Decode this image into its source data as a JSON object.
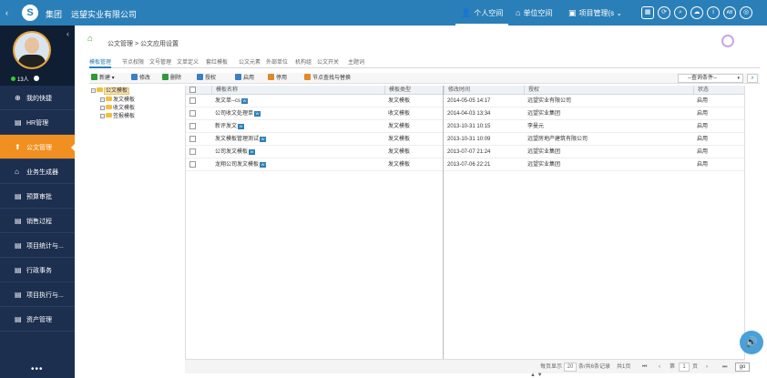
{
  "topbar": {
    "back_icon": "chevron-left-icon",
    "logo_glyph": "S",
    "group_label": "集团",
    "company_name": "远望实业有限公司",
    "nav": [
      {
        "icon": "person-icon",
        "glyph": "👤",
        "label": "个人空间"
      },
      {
        "icon": "home-icon",
        "glyph": "⌂",
        "label": "单位空间"
      },
      {
        "icon": "briefcase-icon",
        "glyph": "▣",
        "label": "项目管理(s"
      }
    ],
    "more_caret": "⌄",
    "icons": [
      {
        "name": "apps-icon",
        "glyph": "▦"
      },
      {
        "name": "refresh-icon",
        "glyph": "⟳"
      },
      {
        "name": "search-icon",
        "glyph": "⌕"
      },
      {
        "name": "cloud-icon",
        "glyph": "☁"
      },
      {
        "name": "info-icon",
        "glyph": "i"
      },
      {
        "name": "font-size-icon",
        "glyph": "AB"
      },
      {
        "name": "settings-icon",
        "glyph": "◎"
      }
    ]
  },
  "sidebar": {
    "online_count": "13人",
    "menu": [
      {
        "label": "我的快捷",
        "glyph": "⊕"
      },
      {
        "label": "HR管理",
        "glyph": "▤"
      },
      {
        "label": "公文管理",
        "glyph": "⬆"
      },
      {
        "label": "业务生成器",
        "glyph": "⌂"
      },
      {
        "label": "预算审批",
        "glyph": "▤"
      },
      {
        "label": "销售过程",
        "glyph": "▤"
      },
      {
        "label": "项目统计与...",
        "glyph": "▤"
      },
      {
        "label": "行政事务",
        "glyph": "▤"
      },
      {
        "label": "项目执行与...",
        "glyph": "▤"
      },
      {
        "label": "资产管理",
        "glyph": "▤"
      }
    ],
    "active_index": 2,
    "more": "•••"
  },
  "content": {
    "breadcrumb": "公文管理 > 公文应用设置",
    "tabs": [
      "模板管理",
      "节点权限",
      "文号管理",
      "文单定义",
      "套红模板",
      "公文元素",
      "外部单位",
      "机构组",
      "公文开关",
      "主题词"
    ],
    "active_tab": 0,
    "toolbar": [
      {
        "label": "新建 ▾",
        "color": "#2e9a3a"
      },
      {
        "label": "修改",
        "color": "#3b7fc6"
      },
      {
        "label": "删除",
        "color": "#2e9a3a"
      },
      {
        "label": "授权",
        "color": "#3b7fc6"
      },
      {
        "label": "启用",
        "color": "#3b7fc6"
      },
      {
        "label": "停用",
        "color": "#e08a2a"
      },
      {
        "label": "节点查找与替换",
        "color": "#e08a2a"
      }
    ],
    "query_label": "--查询条件--",
    "query_caret": "▾",
    "query_search_glyph": "⌕",
    "tree": {
      "root": "公文模板",
      "children": [
        "发文模板",
        "收文模板",
        "签报模板"
      ]
    },
    "grid": {
      "columns": [
        "模板名称",
        "模板类型",
        "修改时间",
        "授权",
        "状态"
      ],
      "badge": "W",
      "rows": [
        {
          "name": "发文单--cs",
          "type": "发文模板",
          "time": "2014-05-05 14:17",
          "auth": "远望实业有限公司",
          "status": "启用"
        },
        {
          "name": "公司收文处理单",
          "type": "收文模板",
          "time": "2014-04-03 13:34",
          "auth": "远望实业集团",
          "status": "启用"
        },
        {
          "name": "新评发文",
          "type": "发文模板",
          "time": "2013-10-31 10:15",
          "auth": "李曼元",
          "status": "启用"
        },
        {
          "name": "发文模板管理测试",
          "type": "发文模板",
          "time": "2013-10-31 10:09",
          "auth": "远望房地产建筑有限公司",
          "status": "启用"
        },
        {
          "name": "公司发文模板",
          "type": "发文模板",
          "time": "2013-07-07 21:24",
          "auth": "远望实业集团",
          "status": "启用"
        },
        {
          "name": "龙翔公司发文模板",
          "type": "发文模板",
          "time": "2013-07-06 22:21",
          "auth": "远望实业集团",
          "status": "启用"
        }
      ]
    },
    "pager": {
      "per_page_label": "每页显示",
      "per_page": "20",
      "summary": "条/共6条记录",
      "total_pages": "共1页",
      "first": "⏮",
      "prev": "‹",
      "page_prefix": "第",
      "page": "1",
      "page_suffix": "页",
      "next": "›",
      "last": "⏭",
      "go": "go"
    },
    "voice_glyph": "🔊",
    "split_handle": "▲ ▼"
  }
}
